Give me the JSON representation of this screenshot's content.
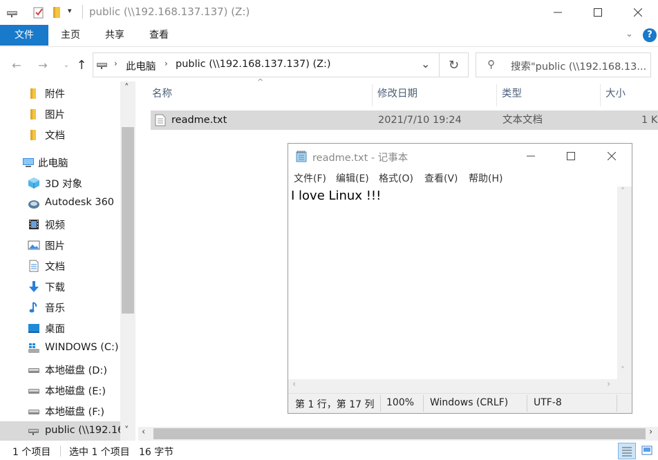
{
  "window": {
    "title": "public (\\\\192.168.137.137) (Z:)"
  },
  "ribbon": {
    "tabs": [
      "文件",
      "主页",
      "共享",
      "查看"
    ]
  },
  "address": {
    "crumbs": [
      "此电脑",
      "public (\\\\192.168.137.137) (Z:)"
    ],
    "search_placeholder": "搜索\"public (\\\\192.168.13..."
  },
  "sidebar": {
    "items": [
      {
        "label": "附件",
        "icon": "folder-icon"
      },
      {
        "label": "图片",
        "icon": "folder-icon"
      },
      {
        "label": "文档",
        "icon": "folder-icon"
      },
      {
        "label": "此电脑",
        "icon": "computer-icon"
      },
      {
        "label": "3D 对象",
        "icon": "3d-objects-icon"
      },
      {
        "label": "Autodesk 360",
        "icon": "autodesk-icon"
      },
      {
        "label": "视频",
        "icon": "video-icon"
      },
      {
        "label": "图片",
        "icon": "pictures-icon"
      },
      {
        "label": "文档",
        "icon": "documents-icon"
      },
      {
        "label": "下载",
        "icon": "download-icon"
      },
      {
        "label": "音乐",
        "icon": "music-icon"
      },
      {
        "label": "桌面",
        "icon": "desktop-icon"
      },
      {
        "label": "WINDOWS (C:)",
        "icon": "windows-drive-icon"
      },
      {
        "label": "本地磁盘 (D:)",
        "icon": "drive-icon"
      },
      {
        "label": "本地磁盘 (E:)",
        "icon": "drive-icon"
      },
      {
        "label": "本地磁盘 (F:)",
        "icon": "drive-icon"
      },
      {
        "label": "public (\\\\192.16",
        "icon": "network-drive-icon"
      }
    ]
  },
  "table": {
    "columns": [
      "名称",
      "修改日期",
      "类型",
      "大小"
    ],
    "rows": [
      {
        "name": "readme.txt",
        "modified": "2021/7/10 19:24",
        "type": "文本文档",
        "size": "1 K"
      }
    ]
  },
  "status": {
    "item_count": "1 个项目",
    "selected": "选中 1 个项目",
    "size": "16 字节"
  },
  "notepad": {
    "title": "readme.txt - 记事本",
    "menu": [
      "文件(F)",
      "编辑(E)",
      "格式(O)",
      "查看(V)",
      "帮助(H)"
    ],
    "content": "I love Linux !!!",
    "status": {
      "position": "第 1 行，第 17 列",
      "zoom": "100%",
      "line_ending": "Windows (CRLF)",
      "encoding": "UTF-8"
    }
  },
  "colors": {
    "accent": "#1979ca",
    "selection": "#d9d9d9",
    "header_text": "#4c607a"
  }
}
